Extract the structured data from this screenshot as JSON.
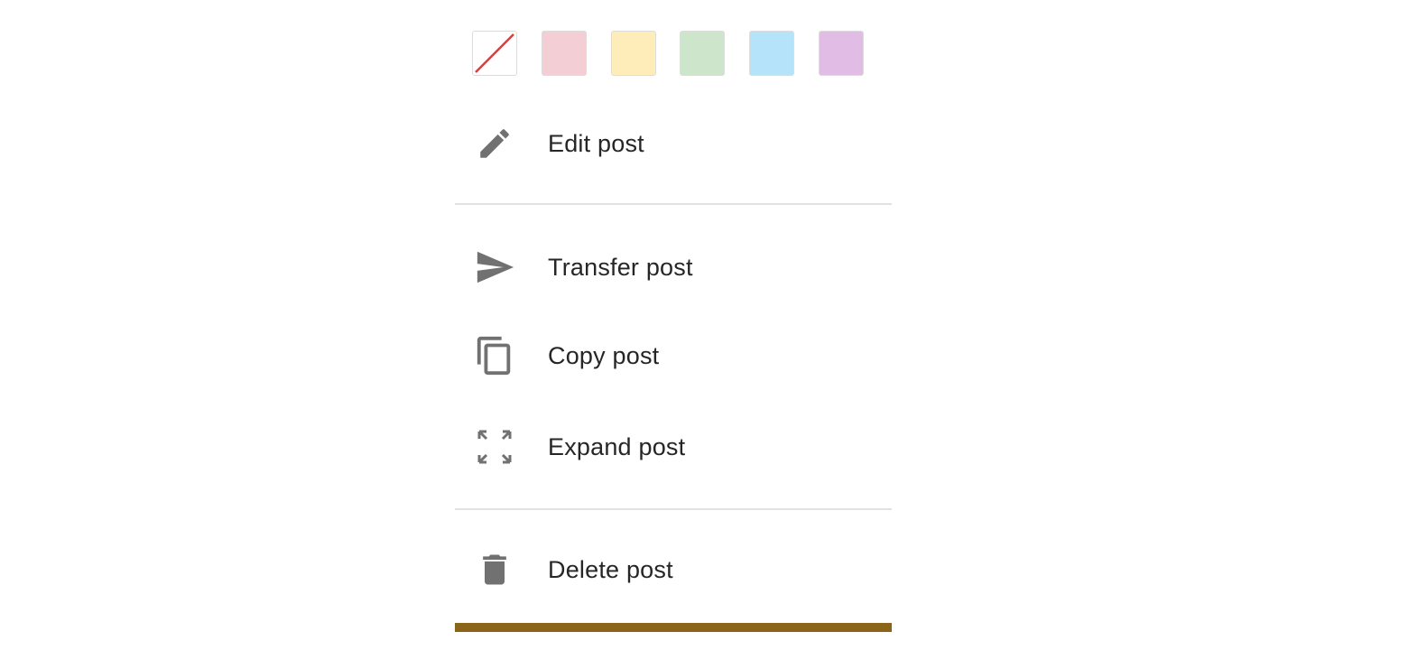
{
  "colors": {
    "swatches": [
      "none",
      "#f4ced5",
      "#feedb8",
      "#cde6cb",
      "#b5e3f9",
      "#e1bde6"
    ],
    "icon": "#717171",
    "text": "#262626",
    "divider": "#e2e2e2",
    "bottom_bar": "#8a6418",
    "no_color_slash": "#e53935"
  },
  "swatches": [
    {
      "name": "no-color",
      "icon": "diagonal-slash-icon"
    },
    {
      "name": "pink"
    },
    {
      "name": "yellow"
    },
    {
      "name": "green"
    },
    {
      "name": "blue"
    },
    {
      "name": "purple"
    }
  ],
  "menu": {
    "edit": {
      "label": "Edit post",
      "icon": "pencil-icon"
    },
    "transfer": {
      "label": "Transfer post",
      "icon": "send-icon"
    },
    "copy": {
      "label": "Copy post",
      "icon": "copy-icon"
    },
    "expand": {
      "label": "Expand post",
      "icon": "fullscreen-icon"
    },
    "delete": {
      "label": "Delete post",
      "icon": "trash-icon"
    }
  }
}
